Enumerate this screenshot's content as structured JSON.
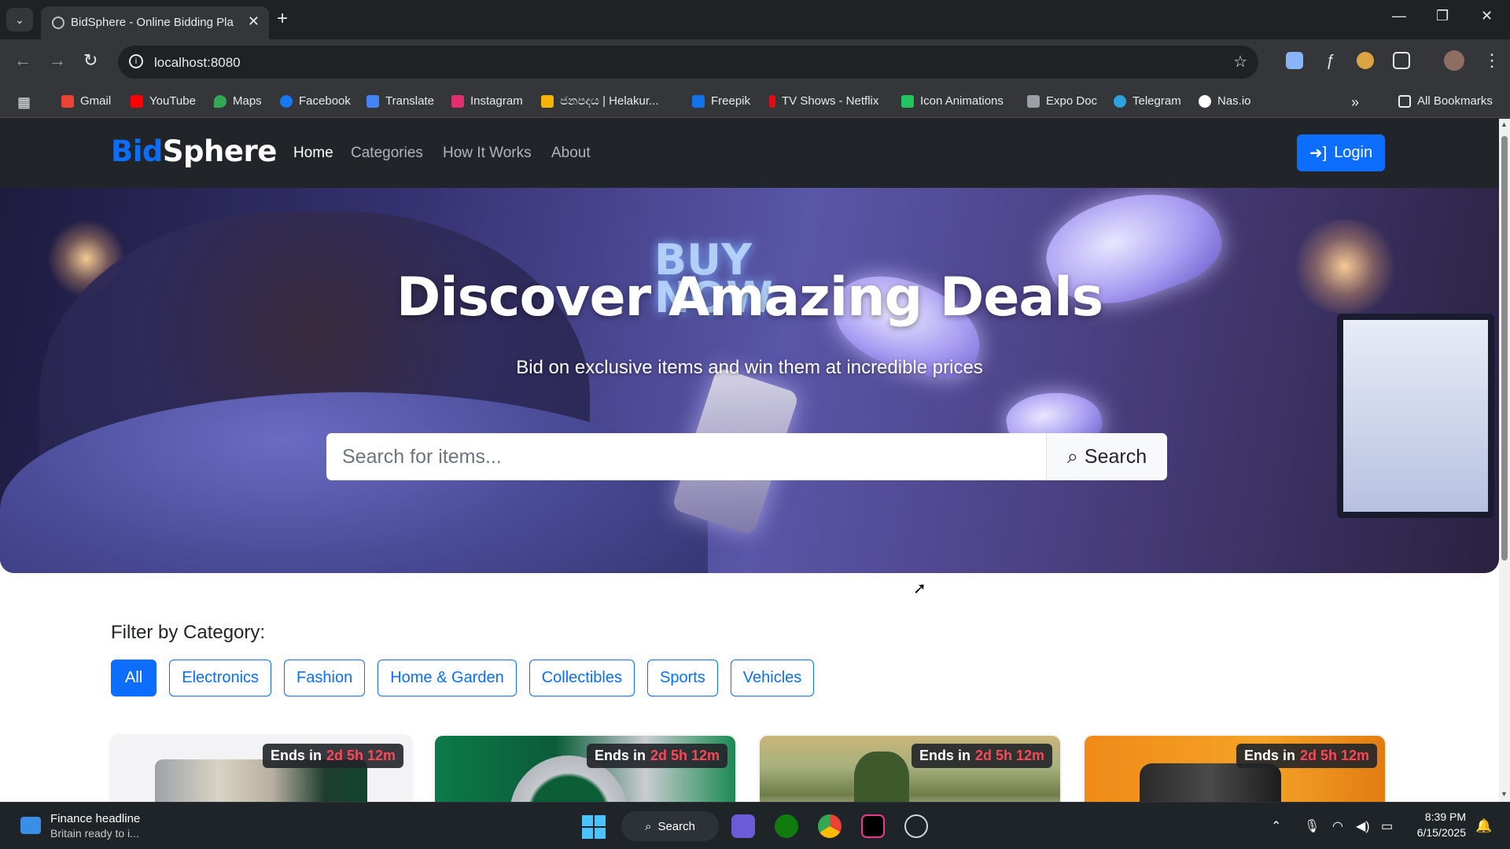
{
  "browser": {
    "tab_title": "BidSphere - Online Bidding Pla",
    "url": "localhost:8080",
    "bookmarks": [
      {
        "label": "Gmail",
        "color": "#ea4335"
      },
      {
        "label": "YouTube",
        "color": "#ff0000"
      },
      {
        "label": "Maps",
        "color": "#34a853"
      },
      {
        "label": "Facebook",
        "color": "#1877f2"
      },
      {
        "label": "Translate",
        "color": "#4285f4"
      },
      {
        "label": "Instagram",
        "color": "#e1306c"
      },
      {
        "label": "ජනපදය | Helakur...",
        "color": "#f4b400"
      },
      {
        "label": "Freepik",
        "color": "#1273eb"
      },
      {
        "label": "TV Shows - Netflix",
        "color": "#e50914"
      },
      {
        "label": "Icon Animations",
        "color": "#22c55e"
      },
      {
        "label": "Expo Doc",
        "color": "#9aa0a6"
      },
      {
        "label": "Telegram",
        "color": "#2aa3df"
      },
      {
        "label": "Nas.io",
        "color": "#ffffff"
      }
    ],
    "all_bookmarks": "All Bookmarks",
    "more_bookmarks": "»"
  },
  "site": {
    "logo_part1": "Bid",
    "logo_part2": "Sphere",
    "nav": [
      "Home",
      "Categories",
      "How It Works",
      "About"
    ],
    "login_label": "Login",
    "brand_color": "#0d6efd"
  },
  "hero": {
    "neon_sign": "BUY NOW",
    "title": "Discover Amazing Deals",
    "subtitle": "Bid on exclusive items and win them at incredible prices",
    "search_placeholder": "Search for items...",
    "search_button": "Search"
  },
  "filters": {
    "title": "Filter by Category:",
    "categories": [
      "All",
      "Electronics",
      "Fashion",
      "Home & Garden",
      "Collectibles",
      "Sports",
      "Vehicles"
    ],
    "active": "All"
  },
  "cards": [
    {
      "badge_prefix": "Ends in",
      "badge_time": "2d 5h 12m",
      "image": "iphone-lineup"
    },
    {
      "badge_prefix": "Ends in",
      "badge_time": "2d 5h 12m",
      "image": "green-dial-watch"
    },
    {
      "badge_prefix": "Ends in",
      "badge_time": "2d 5h 12m",
      "image": "landscape-painting"
    },
    {
      "badge_prefix": "Ends in",
      "badge_time": "2d 5h 12m",
      "image": "camera-in-hands"
    }
  ],
  "taskbar": {
    "news_title": "Finance headline",
    "news_sub": "Britain ready to i...",
    "search_label": "Search",
    "time": "8:39 PM",
    "date": "6/15/2025"
  }
}
